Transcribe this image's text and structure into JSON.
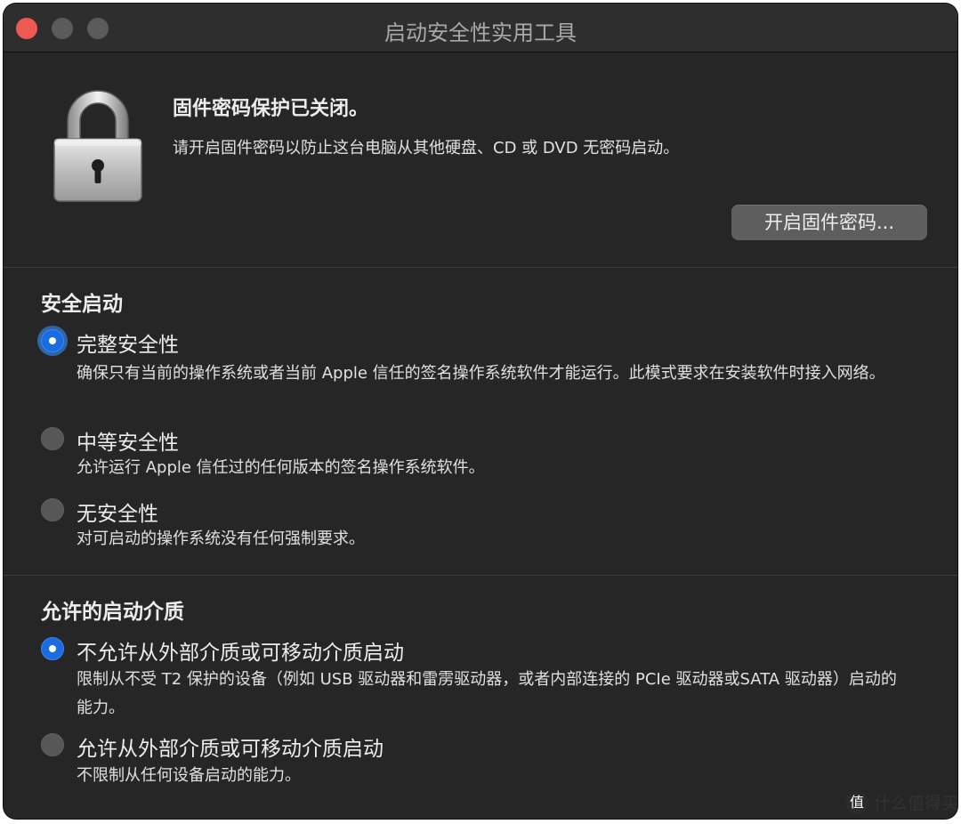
{
  "window": {
    "title": "启动安全性实用工具"
  },
  "firmware": {
    "icon": "lock-icon",
    "title": "固件密码保护已关闭。",
    "description": "请开启固件密码以防止这台电脑从其他硬盘、CD 或 DVD 无密码启动。",
    "button_label": "开启固件密码..."
  },
  "secure_boot": {
    "heading": "安全启动",
    "options": [
      {
        "label": "完整安全性",
        "selected": true,
        "description": "确保只有当前的操作系统或者当前 Apple 信任的签名操作系统软件才能运行。此模式要求在安装软件时接入网络。"
      },
      {
        "label": "中等安全性",
        "selected": false,
        "description": "允许运行 Apple 信任过的任何版本的签名操作系统软件。"
      },
      {
        "label": "无安全性",
        "selected": false,
        "description": "对可启动的操作系统没有任何强制要求。"
      }
    ]
  },
  "boot_media": {
    "heading": "允许的启动介质",
    "options": [
      {
        "label": "不允许从外部介质或可移动介质启动",
        "selected": true,
        "description": "限制从不受 T2 保护的设备（例如 USB 驱动器和雷雳驱动器，或者内部连接的 PCIe 驱动器或SATA 驱动器）启动的能力。"
      },
      {
        "label": "允许从外部介质或可移动介质启动",
        "selected": false,
        "description": "不限制从任何设备启动的能力。"
      }
    ]
  },
  "watermark": {
    "icon_text": "值",
    "text": "什么值得买"
  },
  "colors": {
    "accent": "#1a6de0",
    "window_bg": "#262626",
    "close_button": "#ee5a52"
  }
}
